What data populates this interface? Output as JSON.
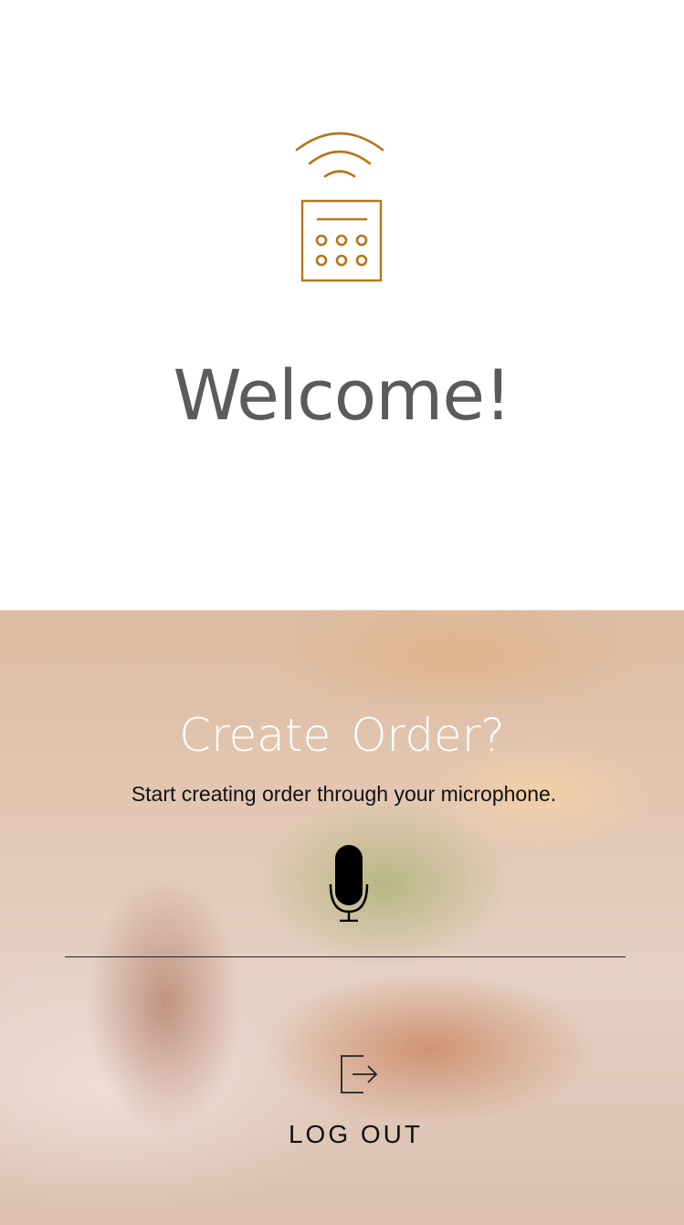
{
  "header": {
    "title": "Welcome!",
    "logo_icon": "wireless-remote-icon",
    "accent_color": "#b8741a"
  },
  "order": {
    "title": "Create  Order?",
    "subtitle": "Start creating order through your microphone.",
    "mic_icon": "microphone-icon"
  },
  "logout": {
    "label": "LOG OUT",
    "icon": "logout-icon"
  }
}
